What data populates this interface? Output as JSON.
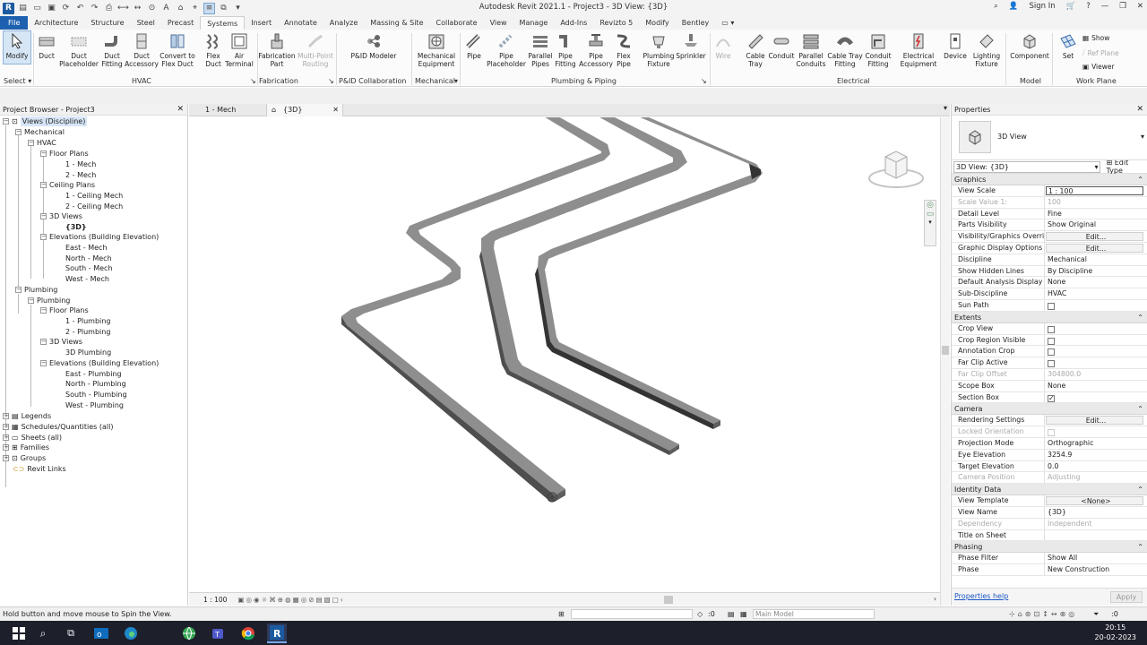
{
  "window": {
    "title": "Autodesk Revit 2021.1 - Project3 - 3D View: {3D}",
    "sign_in": "Sign In"
  },
  "menu": {
    "tabs": [
      "File",
      "Architecture",
      "Structure",
      "Steel",
      "Precast",
      "Systems",
      "Insert",
      "Annotate",
      "Analyze",
      "Massing & Site",
      "Collaborate",
      "View",
      "Manage",
      "Add-Ins",
      "Revizto 5",
      "Modify",
      "Bentley"
    ],
    "active": "Systems"
  },
  "ribbon": {
    "modify": "Modify",
    "select": "Select",
    "hvac": {
      "panel": "HVAC",
      "buttons": [
        "Duct",
        "Duct Placeholder",
        "Duct Fitting",
        "Duct Accessory",
        "Convert to Flex Duct",
        "Flex Duct",
        "Air Terminal"
      ]
    },
    "fabrication": {
      "panel": "Fabrication",
      "buttons": [
        "Fabrication Part",
        "Multi-Point Routing"
      ]
    },
    "pid": {
      "panel": "P&ID Collaboration",
      "buttons": [
        "P&ID Modeler"
      ]
    },
    "mechanical": {
      "panel": "Mechanical",
      "buttons": [
        "Mechanical Equipment"
      ]
    },
    "plumbing": {
      "panel": "Plumbing & Piping",
      "buttons": [
        "Pipe",
        "Pipe Placeholder",
        "Parallel Pipes",
        "Pipe Fitting",
        "Pipe Accessory",
        "Flex Pipe",
        "Plumbing Fixture",
        "Sprinkler"
      ]
    },
    "electrical": {
      "panel": "Electrical",
      "buttons": [
        "Wire",
        "Cable Tray",
        "Conduit",
        "Parallel Conduits",
        "Cable Tray Fitting",
        "Conduit Fitting",
        "Electrical Equipment",
        "Device",
        "Lighting Fixture"
      ]
    },
    "model": {
      "panel": "Model",
      "buttons": [
        "Component"
      ]
    },
    "workplane": {
      "panel": "Work Plane",
      "set": "Set",
      "show": "Show",
      "ref_plane": "Ref Plane",
      "viewer": "Viewer"
    }
  },
  "project_browser": {
    "title": "Project Browser - Project3",
    "items": [
      "Views (Discipline)",
      "Mechanical",
      "HVAC",
      "Floor Plans",
      "1 - Mech",
      "2 - Mech",
      "Ceiling Plans",
      "1 - Ceiling Mech",
      "2 - Ceiling Mech",
      "3D Views",
      "{3D}",
      "Elevations (Building Elevation)",
      "East - Mech",
      "North - Mech",
      "South - Mech",
      "West - Mech",
      "Plumbing",
      "Plumbing",
      "Floor Plans",
      "1 - Plumbing",
      "2 - Plumbing",
      "3D Views",
      "3D Plumbing",
      "Elevations (Building Elevation)",
      "East - Plumbing",
      "North - Plumbing",
      "South - Plumbing",
      "West - Plumbing",
      "Legends",
      "Schedules/Quantities (all)",
      "Sheets (all)",
      "Families",
      "Groups",
      "Revit Links"
    ]
  },
  "view_tabs": [
    "1 - Mech",
    "{3D}"
  ],
  "view_bar": {
    "scale": "1 : 100"
  },
  "properties": {
    "title": "Properties",
    "type_name": "3D View",
    "selector": "3D View: {3D}",
    "edit_type": "Edit Type",
    "groups": [
      {
        "name": "Graphics",
        "rows": [
          {
            "k": "View Scale",
            "v": "1 : 100"
          },
          {
            "k": "Scale Value    1:",
            "v": "100"
          },
          {
            "k": "Detail Level",
            "v": "Fine"
          },
          {
            "k": "Parts Visibility",
            "v": "Show Original"
          },
          {
            "k": "Visibility/Graphics Overrid...",
            "v": "Edit..."
          },
          {
            "k": "Graphic Display Options",
            "v": "Edit..."
          },
          {
            "k": "Discipline",
            "v": "Mechanical"
          },
          {
            "k": "Show Hidden Lines",
            "v": "By Discipline"
          },
          {
            "k": "Default Analysis Display S...",
            "v": "None"
          },
          {
            "k": "Sub-Discipline",
            "v": "HVAC"
          },
          {
            "k": "Sun Path",
            "v": ""
          }
        ]
      },
      {
        "name": "Extents",
        "rows": [
          {
            "k": "Crop View",
            "v": ""
          },
          {
            "k": "Crop Region Visible",
            "v": ""
          },
          {
            "k": "Annotation Crop",
            "v": ""
          },
          {
            "k": "Far Clip Active",
            "v": ""
          },
          {
            "k": "Far Clip Offset",
            "v": "304800.0"
          },
          {
            "k": "Scope Box",
            "v": "None"
          },
          {
            "k": "Section Box",
            "v": ""
          }
        ]
      },
      {
        "name": "Camera",
        "rows": [
          {
            "k": "Rendering Settings",
            "v": "Edit..."
          },
          {
            "k": "Locked Orientation",
            "v": ""
          },
          {
            "k": "Projection Mode",
            "v": "Orthographic"
          },
          {
            "k": "Eye Elevation",
            "v": "3254.9"
          },
          {
            "k": "Target Elevation",
            "v": "0.0"
          },
          {
            "k": "Camera Position",
            "v": "Adjusting"
          }
        ]
      },
      {
        "name": "Identity Data",
        "rows": [
          {
            "k": "View Template",
            "v": "<None>"
          },
          {
            "k": "View Name",
            "v": "{3D}"
          },
          {
            "k": "Dependency",
            "v": "Independent"
          },
          {
            "k": "Title on Sheet",
            "v": ""
          }
        ]
      },
      {
        "name": "Phasing",
        "rows": [
          {
            "k": "Phase Filter",
            "v": "Show All"
          },
          {
            "k": "Phase",
            "v": "New Construction"
          }
        ]
      }
    ],
    "help": "Properties help",
    "apply": "Apply"
  },
  "status": {
    "message": "Hold button and move mouse to Spin the View.",
    "selection": ":0",
    "model": "Main Model"
  },
  "clock": {
    "time": "20:15",
    "date": "20-02-2023"
  }
}
